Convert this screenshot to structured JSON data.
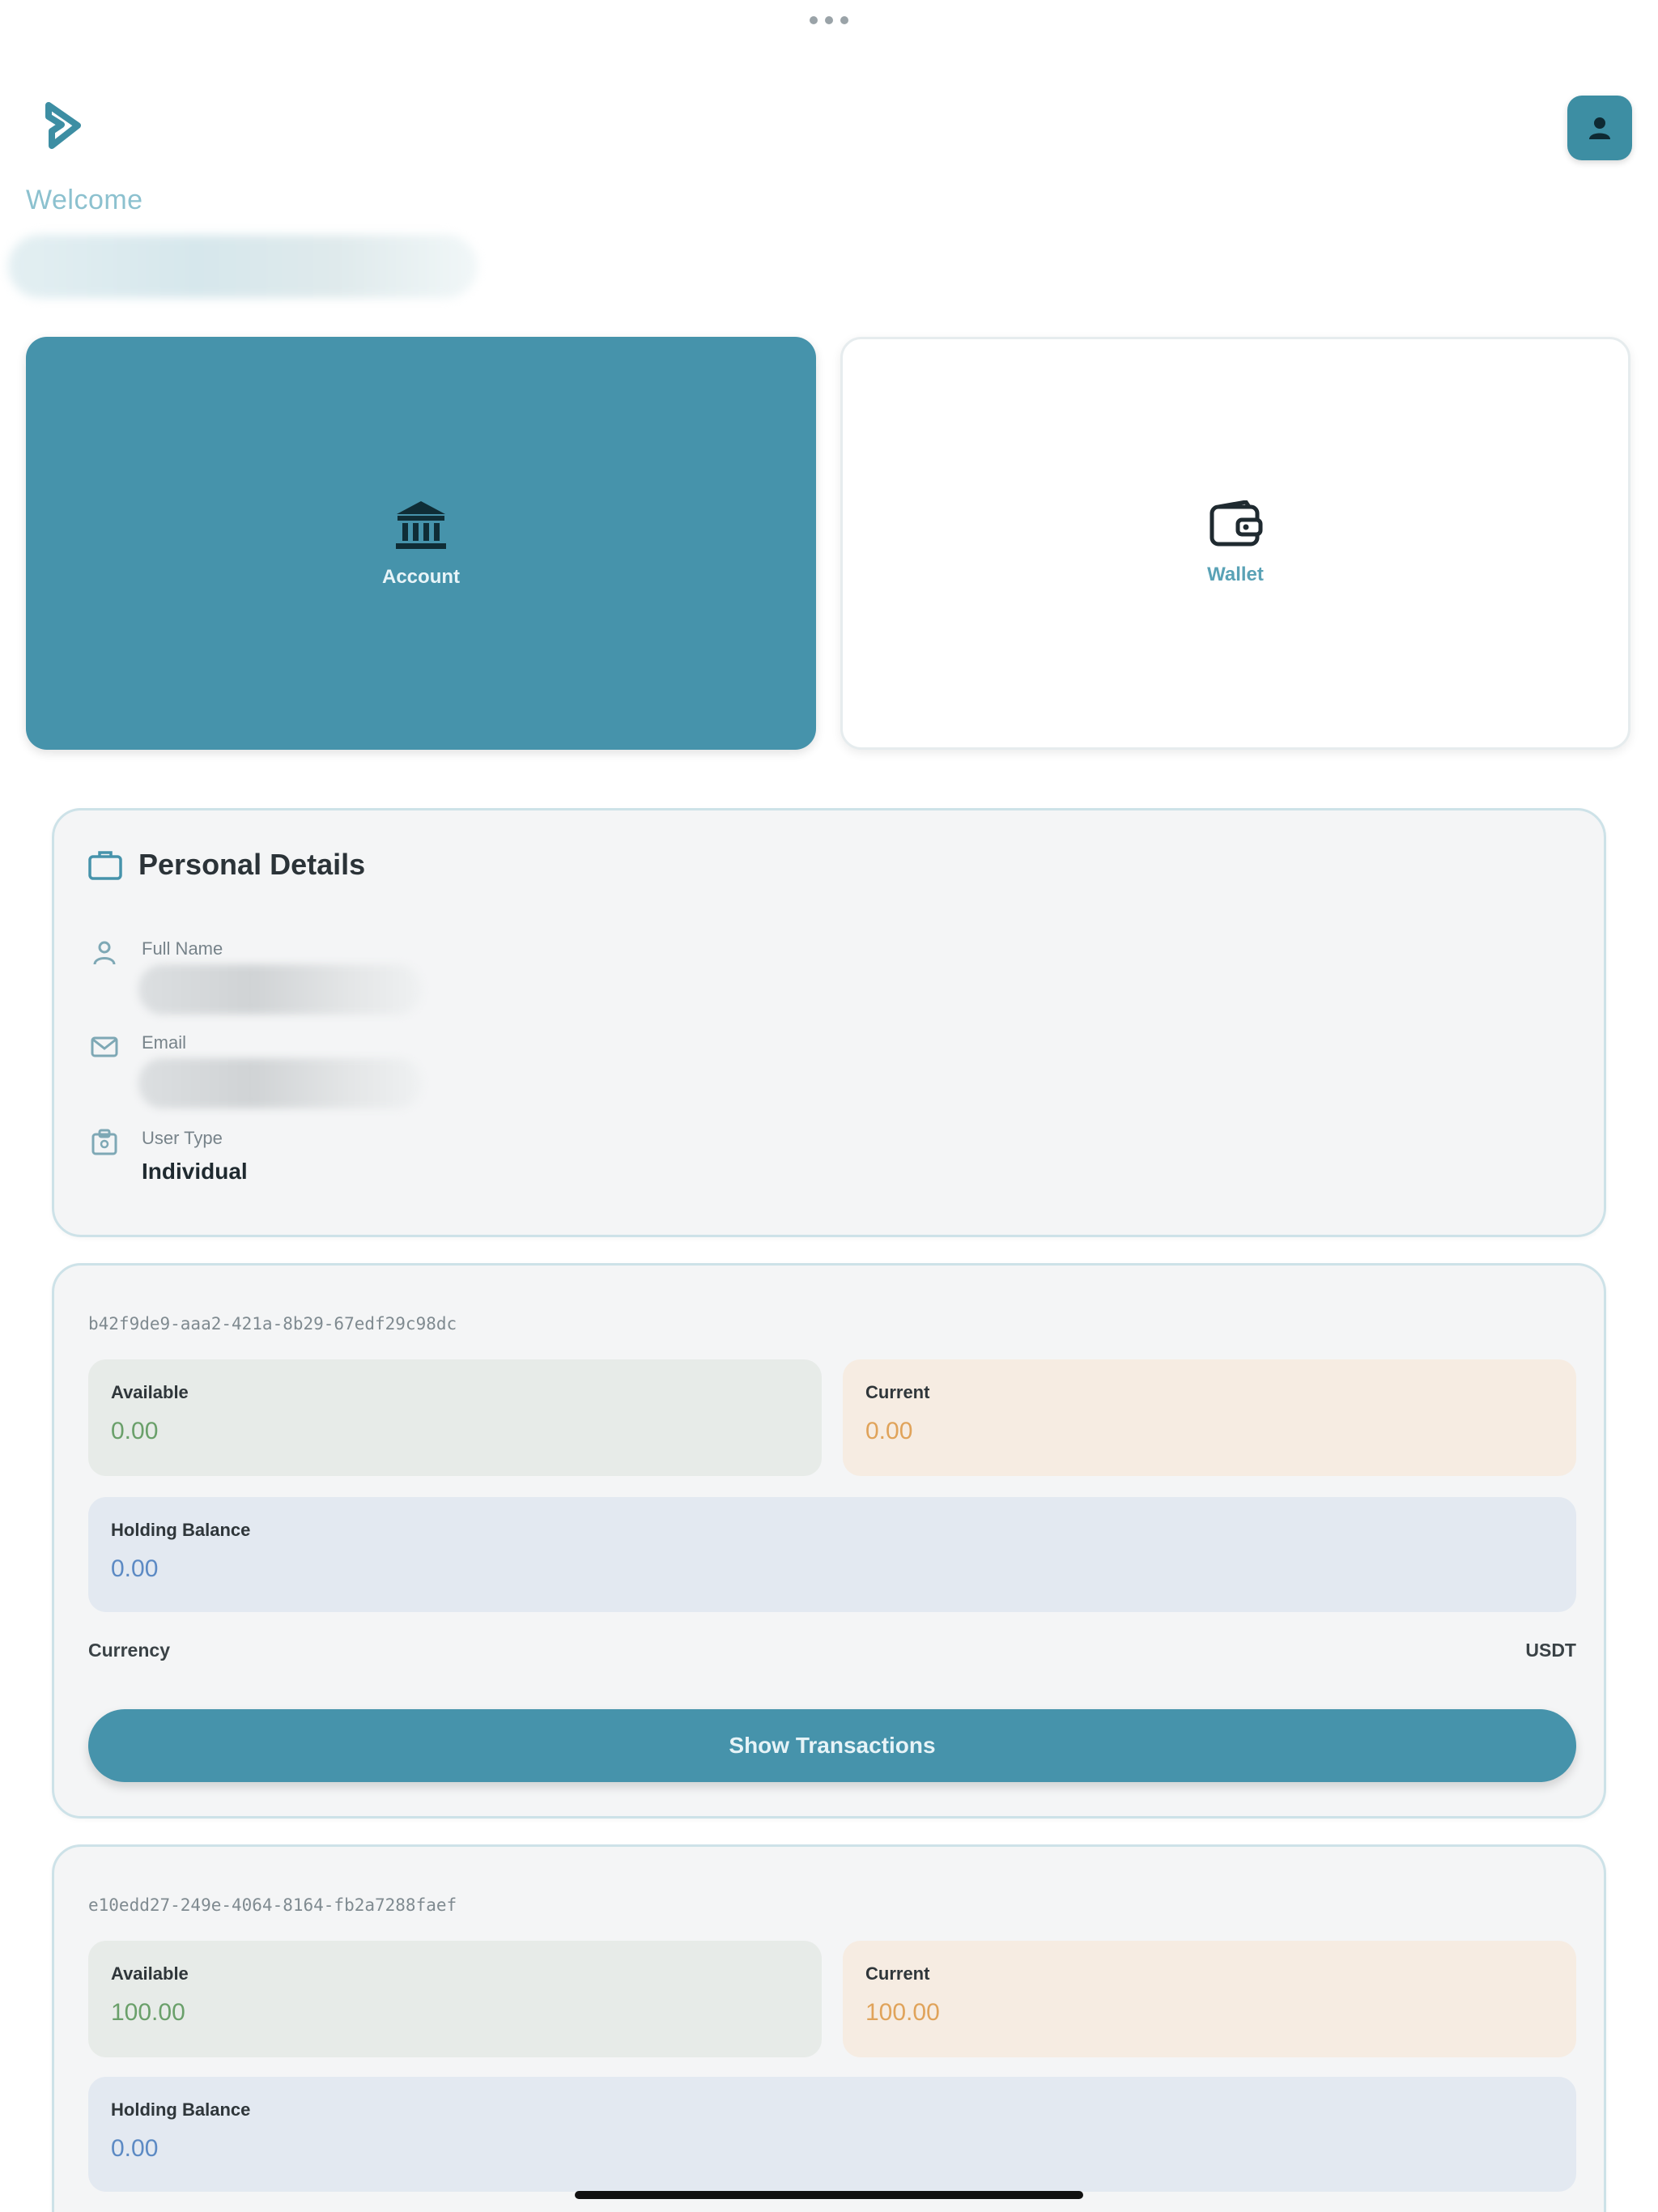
{
  "header": {
    "welcome_label": "Welcome",
    "logo_icon": "play-arrow-logo-icon",
    "profile_icon": "user-icon"
  },
  "tabs": [
    {
      "label": "Account",
      "icon": "bank-icon",
      "active": true
    },
    {
      "label": "Wallet",
      "icon": "wallet-icon",
      "active": false
    }
  ],
  "personal_details": {
    "title": "Personal Details",
    "full_name_label": "Full Name",
    "email_label": "Email",
    "user_type_label": "User Type",
    "user_type_value": "Individual"
  },
  "wallets": [
    {
      "id": "b42f9de9-aaa2-421a-8b29-67edf29c98dc",
      "available_label": "Available",
      "available_value": "0.00",
      "current_label": "Current",
      "current_value": "0.00",
      "holding_label": "Holding Balance",
      "holding_value": "0.00",
      "currency_label": "Currency",
      "currency_value": "USDT",
      "button_label": "Show Transactions"
    },
    {
      "id": "e10edd27-249e-4064-8164-fb2a7288faef",
      "available_label": "Available",
      "available_value": "100.00",
      "current_label": "Current",
      "current_value": "100.00",
      "holding_label": "Holding Balance",
      "holding_value": "0.00"
    }
  ],
  "colors": {
    "primary": "#4693ab",
    "available_text": "#6aa06a",
    "current_text": "#e0a35a",
    "holding_text": "#5c8ac4"
  }
}
